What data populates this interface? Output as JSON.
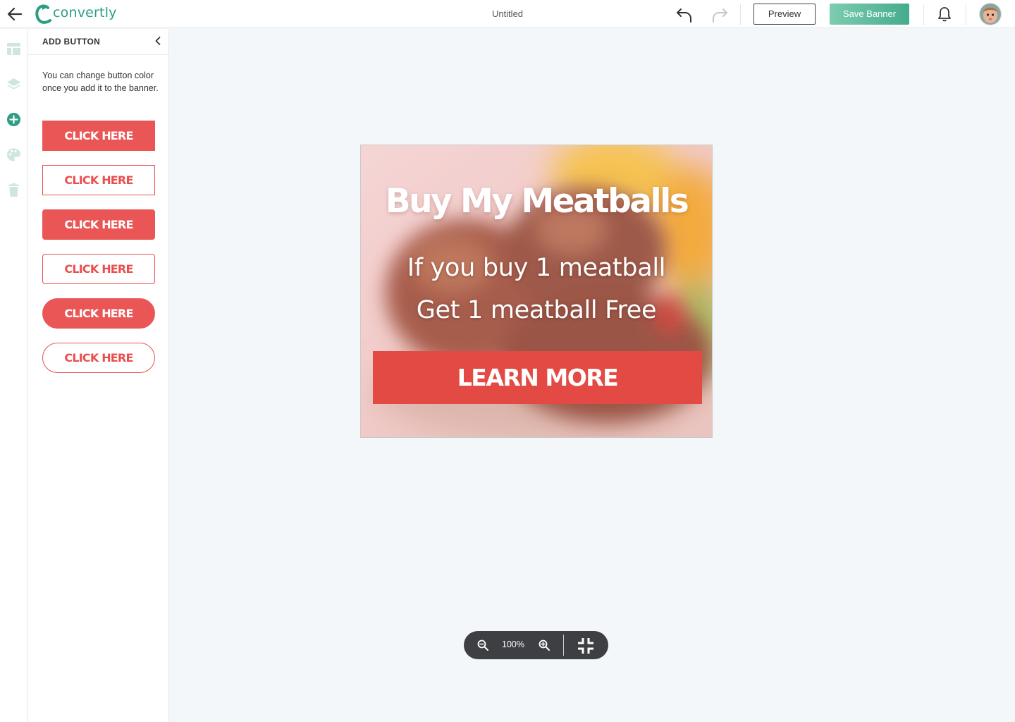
{
  "app": {
    "logo_text": "convertly",
    "document_title": "Untitled",
    "brand_color": "#2a9d83"
  },
  "toolbar": {
    "back_icon": "arrow-left-icon",
    "undo_icon": "undo-icon",
    "redo_icon": "redo-icon",
    "preview_label": "Preview",
    "save_label": "Save Banner",
    "notifications_icon": "bell-icon",
    "avatar": "user-avatar"
  },
  "rail": {
    "items": [
      {
        "icon": "layout-icon",
        "active": false
      },
      {
        "icon": "layers-icon",
        "active": false
      },
      {
        "icon": "add-circle-icon",
        "active": true
      },
      {
        "icon": "palette-icon",
        "active": false
      },
      {
        "icon": "trash-icon",
        "active": false
      }
    ]
  },
  "panel": {
    "title": "ADD BUTTON",
    "help_text": "You can change button color once you add it to the banner.",
    "button_color": "#ea5655",
    "buttons": [
      {
        "label": "CLICK HERE",
        "style": "solid-square"
      },
      {
        "label": "CLICK HERE",
        "style": "outline-square"
      },
      {
        "label": "CLICK HERE",
        "style": "solid-rounded"
      },
      {
        "label": "CLICK HERE",
        "style": "outline-rounded"
      },
      {
        "label": "CLICK HERE",
        "style": "solid-pill"
      },
      {
        "label": "CLICK HERE",
        "style": "outline-pill"
      }
    ]
  },
  "banner": {
    "headline": "Buy My Meatballs",
    "line1": "If you buy 1 meatball",
    "line2": "Get 1 meatball Free",
    "cta_label": "LEARN MORE",
    "cta_color": "#e34a44"
  },
  "zoom": {
    "level": "100%",
    "zoom_out_icon": "zoom-out-icon",
    "zoom_in_icon": "zoom-in-icon",
    "fit_icon": "collapse-icon"
  }
}
